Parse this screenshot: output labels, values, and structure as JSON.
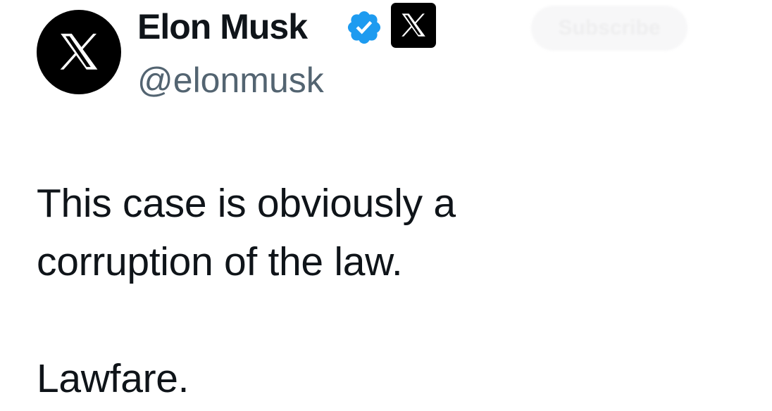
{
  "author": {
    "display_name": "Elon Musk",
    "handle": "@elonmusk",
    "avatar_icon": "x-logo-icon",
    "verified_icon": "verified-badge-icon",
    "verified_color": "#1d9bf0",
    "affiliate_icon": "x-logo-icon"
  },
  "follow_button": {
    "label": "Subscribe"
  },
  "tweet": {
    "line1": "This case is obviously a",
    "line2": "corruption of the law.",
    "line3": "Lawfare."
  }
}
